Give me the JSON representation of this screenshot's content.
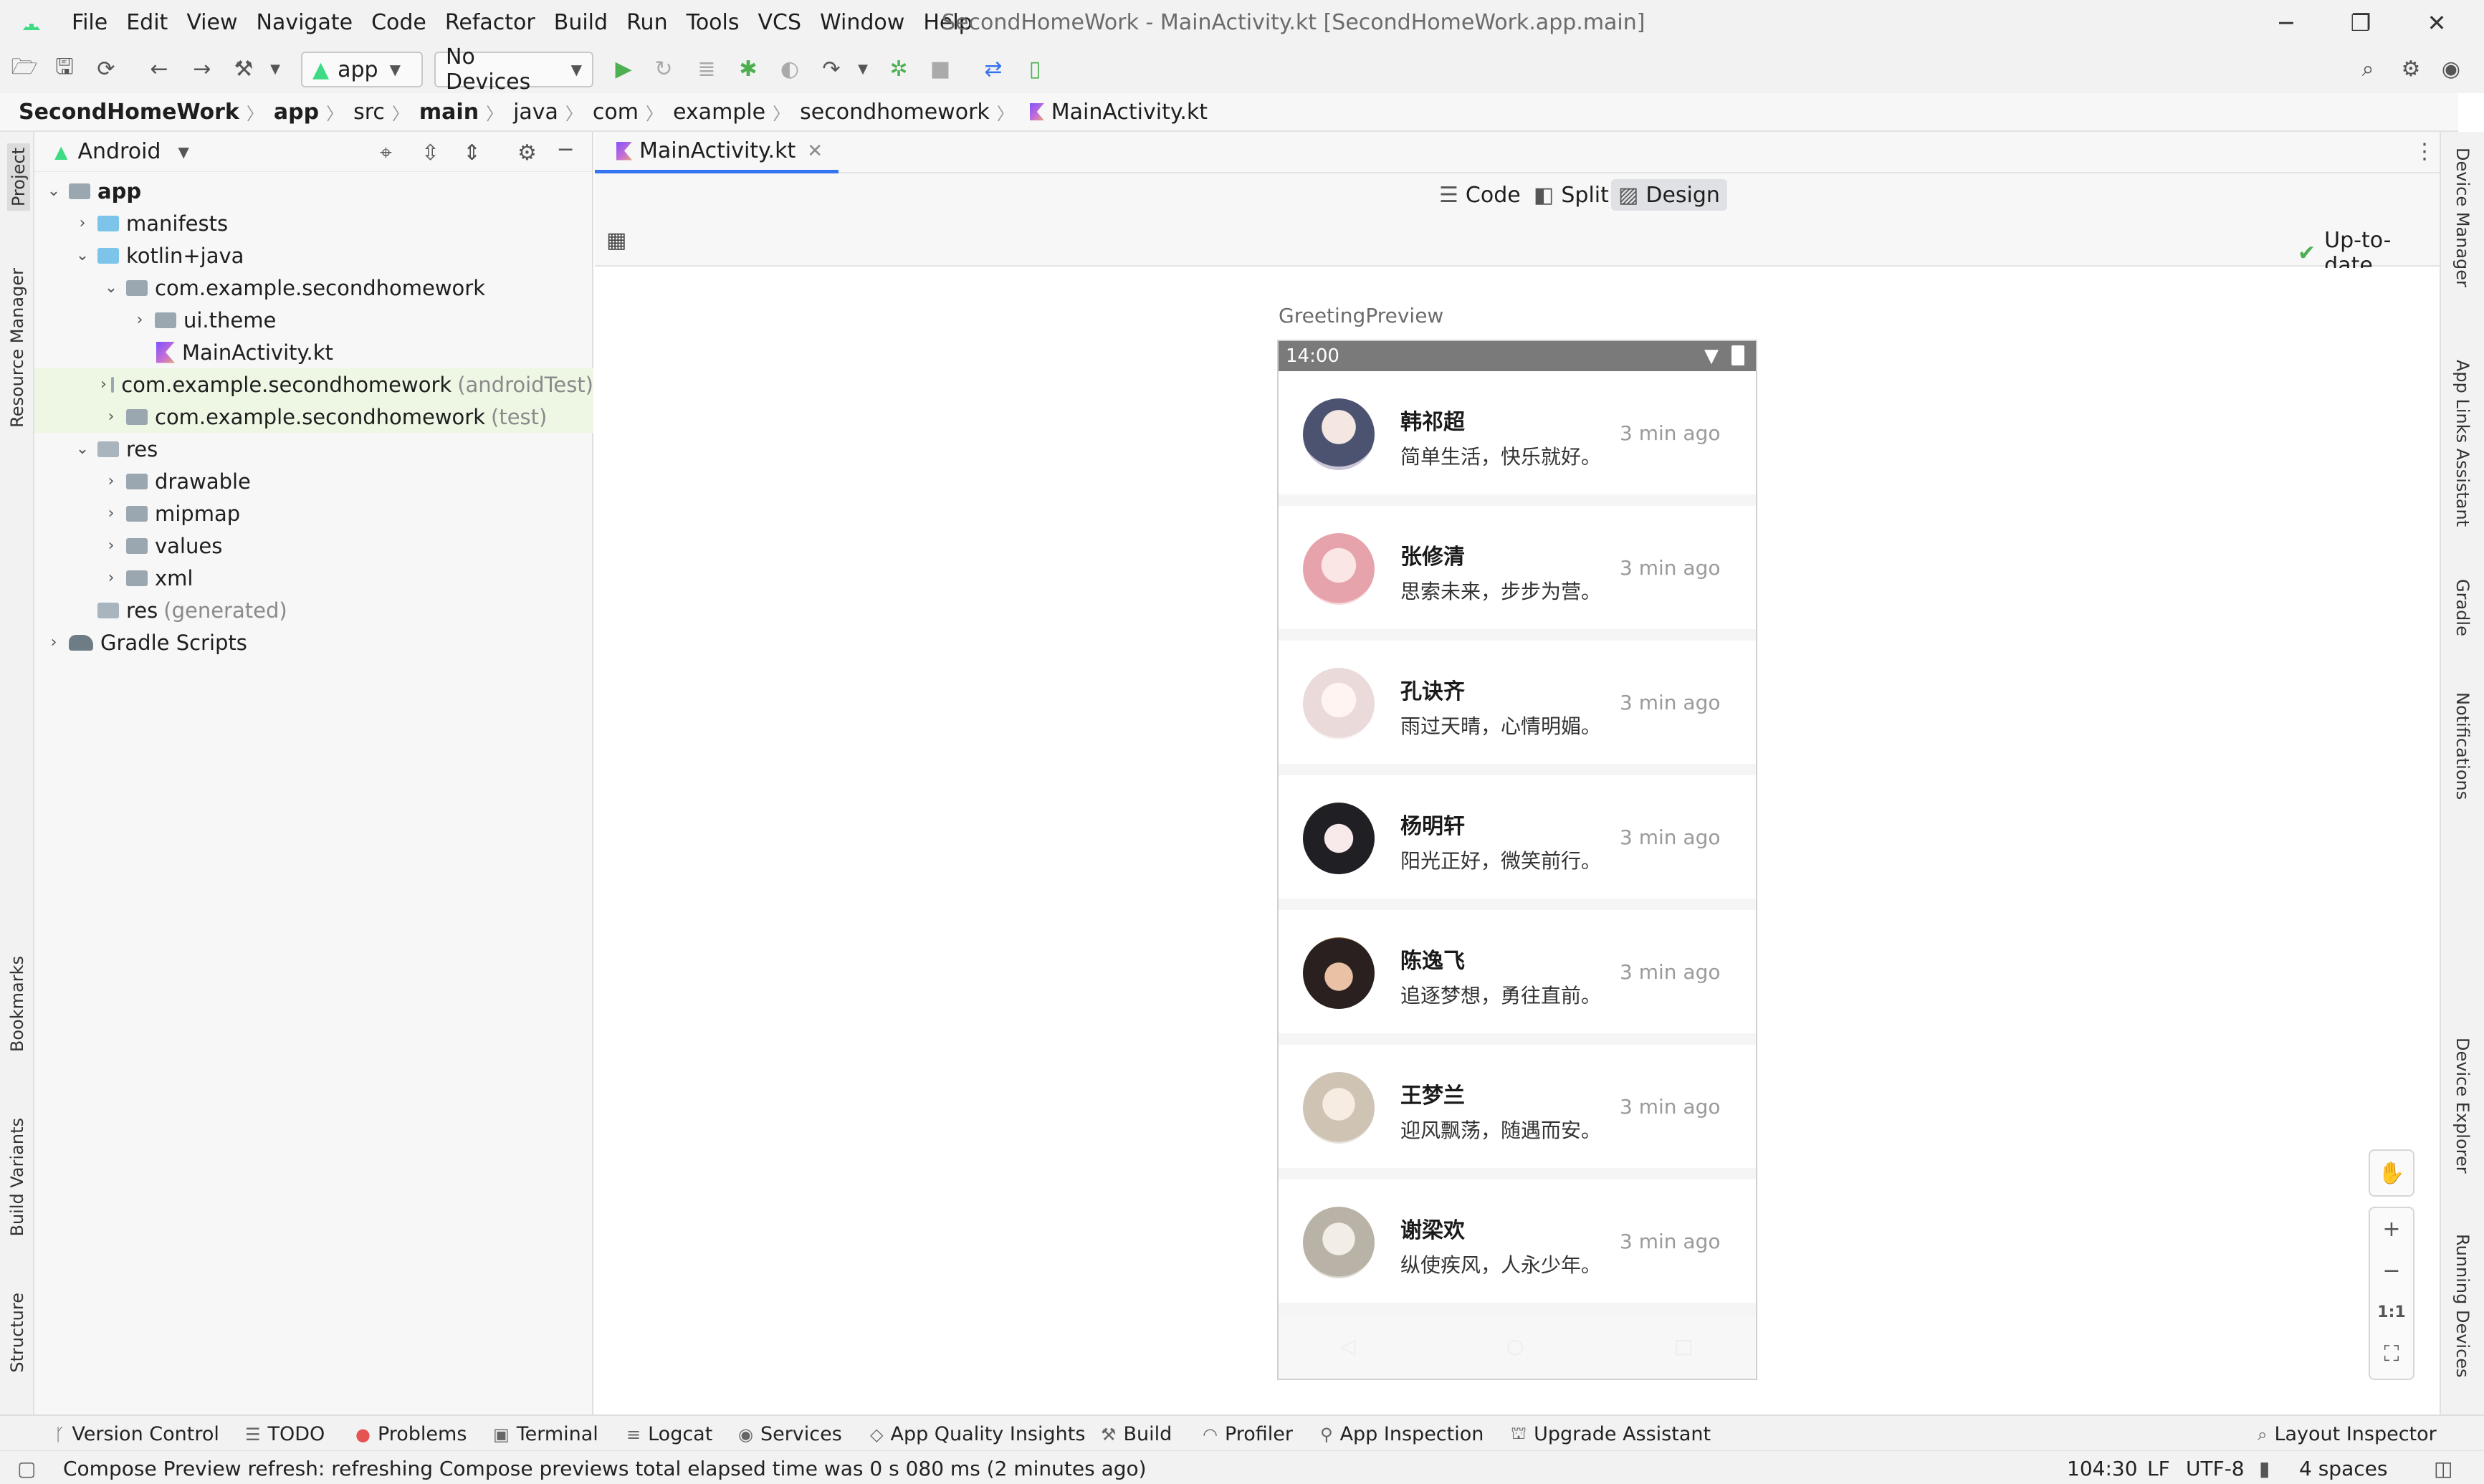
{
  "menu": [
    "File",
    "Edit",
    "View",
    "Navigate",
    "Code",
    "Refactor",
    "Build",
    "Run",
    "Tools",
    "VCS",
    "Window",
    "Help"
  ],
  "window_title": "SecondHomeWork - MainActivity.kt [SecondHomeWork.app.main]",
  "toolbar": {
    "run_config": "app",
    "device": "No Devices"
  },
  "breadcrumb": [
    "SecondHomeWork",
    "app",
    "src",
    "main",
    "java",
    "com",
    "example",
    "secondhomework",
    "MainActivity.kt"
  ],
  "project": {
    "view": "Android",
    "tree": [
      {
        "label": "app",
        "extra": ""
      },
      {
        "label": "manifests",
        "extra": ""
      },
      {
        "label": "kotlin+java",
        "extra": ""
      },
      {
        "label": "com.example.secondhomework",
        "extra": ""
      },
      {
        "label": "ui.theme",
        "extra": ""
      },
      {
        "label": "MainActivity.kt",
        "extra": ""
      },
      {
        "label": "com.example.secondhomework",
        "extra": "(androidTest)"
      },
      {
        "label": "com.example.secondhomework",
        "extra": "(test)"
      },
      {
        "label": "res",
        "extra": ""
      },
      {
        "label": "drawable",
        "extra": ""
      },
      {
        "label": "mipmap",
        "extra": ""
      },
      {
        "label": "values",
        "extra": ""
      },
      {
        "label": "xml",
        "extra": ""
      },
      {
        "label": "res",
        "extra": "(generated)"
      },
      {
        "label": "Gradle Scripts",
        "extra": ""
      }
    ]
  },
  "left_stripe": [
    "Project",
    "Resource Manager",
    "Bookmarks",
    "Build Variants",
    "Structure"
  ],
  "right_stripe": [
    "Device Manager",
    "App Links Assistant",
    "Gradle",
    "Notifications",
    "Device Explorer",
    "Running Devices"
  ],
  "editor": {
    "tab": "MainActivity.kt",
    "modes": [
      "Code",
      "Split",
      "Design"
    ],
    "status": "Up-to-date",
    "preview_name": "GreetingPreview",
    "phone_time": "14:00",
    "contacts": [
      {
        "name": "韩祁超",
        "message": "简单生活，快乐就好。",
        "time": "3 min ago"
      },
      {
        "name": "张修清",
        "message": "思索未来，步步为营。",
        "time": "3 min ago"
      },
      {
        "name": "孔诀齐",
        "message": "雨过天晴，心情明媚。",
        "time": "3 min ago"
      },
      {
        "name": "杨明轩",
        "message": "阳光正好，微笑前行。",
        "time": "3 min ago"
      },
      {
        "name": "陈逸飞",
        "message": "追逐梦想，勇往直前。",
        "time": "3 min ago"
      },
      {
        "name": "王梦兰",
        "message": "迎风飘荡，随遇而安。",
        "time": "3 min ago"
      },
      {
        "name": "谢梁欢",
        "message": "纵使疾风，人永少年。",
        "time": "3 min ago"
      }
    ],
    "zoom_labels": [
      "+",
      "−",
      "1:1"
    ]
  },
  "bottom_tools": [
    "Version Control",
    "TODO",
    "Problems",
    "Terminal",
    "Logcat",
    "Services",
    "App Quality Insights",
    "Build",
    "Profiler",
    "App Inspection",
    "Upgrade Assistant"
  ],
  "layout_inspector": "Layout Inspector",
  "status": {
    "message": "Compose Preview refresh: refreshing Compose previews total elapsed time was 0 s 080 ms (2 minutes ago)",
    "position": "104:30",
    "line_sep": "LF",
    "encoding": "UTF-8",
    "indent": "4 spaces"
  },
  "colors": {
    "accent": "#3574f0",
    "highlight_row": "#edf7e4",
    "run_green": "#4caf50"
  }
}
